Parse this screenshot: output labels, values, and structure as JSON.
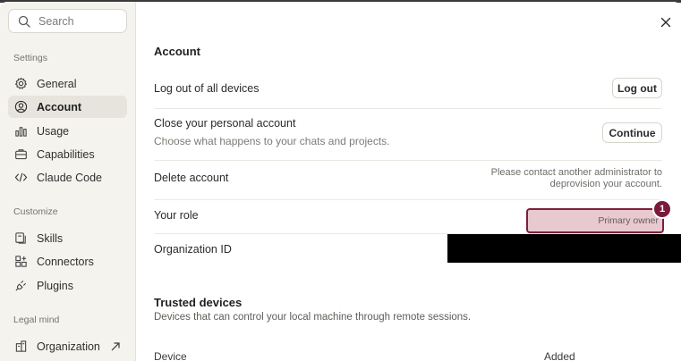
{
  "sidebar": {
    "search_placeholder": "Search",
    "sections": {
      "settings": "Settings",
      "customize": "Customize",
      "legal": "Legal mind"
    },
    "items": [
      {
        "label": "General",
        "icon": "gear-icon",
        "active": false
      },
      {
        "label": "Account",
        "icon": "user-circle-icon",
        "active": true
      },
      {
        "label": "Usage",
        "icon": "bar-chart-icon",
        "active": false
      },
      {
        "label": "Capabilities",
        "icon": "briefcase-icon",
        "active": false
      },
      {
        "label": "Claude Code",
        "icon": "code-icon",
        "active": false
      },
      {
        "label": "Skills",
        "icon": "skills-icon",
        "active": false
      },
      {
        "label": "Connectors",
        "icon": "connectors-icon",
        "active": false
      },
      {
        "label": "Plugins",
        "icon": "plug-icon",
        "active": false
      },
      {
        "label": "Organization",
        "icon": "external-link-icon",
        "active": false
      }
    ]
  },
  "main": {
    "title": "Account",
    "rows": {
      "logout_all": {
        "label": "Log out of all devices",
        "button": "Log out"
      },
      "close_account": {
        "label": "Close your personal account",
        "sub": "Choose what happens to your chats and projects.",
        "button": "Continue"
      },
      "delete_account": {
        "label": "Delete account",
        "note_line1": "Please contact another administrator to",
        "note_line2": "deprovision your account."
      },
      "role": {
        "label": "Your role",
        "value": "Primary owner",
        "badge": "1"
      },
      "org_id": {
        "label": "Organization ID"
      }
    },
    "trusted": {
      "title": "Trusted devices",
      "sub": "Devices that can control your local machine through remote sessions.",
      "columns": [
        "Device",
        "Added"
      ]
    }
  },
  "colors": {
    "accent": "#7a1a3a",
    "highlight_fill": "#e8c9d0",
    "sidebar_bg": "#f4f3ee"
  }
}
